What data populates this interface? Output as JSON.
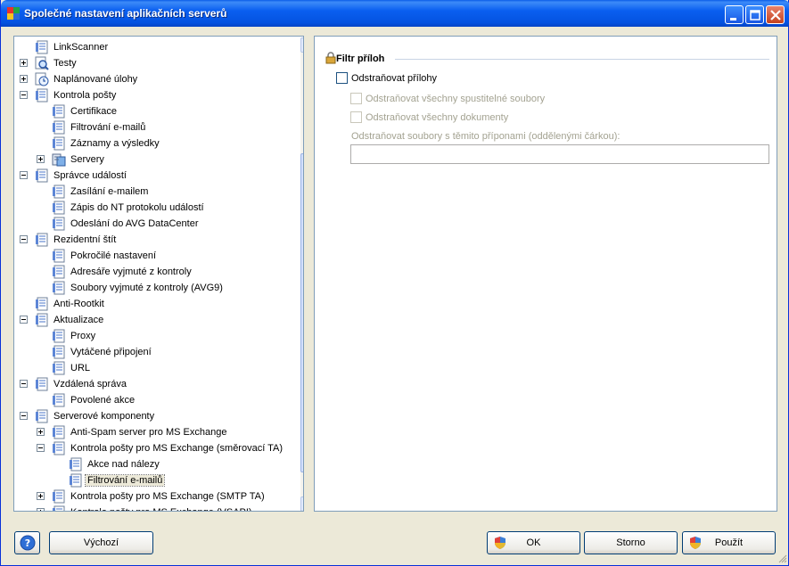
{
  "window": {
    "title": "Společné nastavení aplikačních serverů",
    "accent": "#0a5ee8"
  },
  "tree": {
    "items": [
      {
        "label": "LinkScanner",
        "depth": 0,
        "expander": "none",
        "icon": "document-icon"
      },
      {
        "label": "Testy",
        "depth": 0,
        "expander": "plus",
        "icon": "magnifier-icon"
      },
      {
        "label": "Naplánované úlohy",
        "depth": 0,
        "expander": "plus",
        "icon": "clock-icon"
      },
      {
        "label": "Kontrola pošty",
        "depth": 0,
        "expander": "minus",
        "icon": "document-icon"
      },
      {
        "label": "Certifikace",
        "depth": 1,
        "expander": "none",
        "icon": "document-icon"
      },
      {
        "label": "Filtrování e-mailů",
        "depth": 1,
        "expander": "none",
        "icon": "document-icon"
      },
      {
        "label": "Záznamy a výsledky",
        "depth": 1,
        "expander": "none",
        "icon": "document-icon"
      },
      {
        "label": "Servery",
        "depth": 1,
        "expander": "plus",
        "icon": "server-icon"
      },
      {
        "label": "Správce událostí",
        "depth": 0,
        "expander": "minus",
        "icon": "document-icon"
      },
      {
        "label": "Zasílání e-mailem",
        "depth": 1,
        "expander": "none",
        "icon": "document-icon"
      },
      {
        "label": "Zápis do NT protokolu událostí",
        "depth": 1,
        "expander": "none",
        "icon": "document-icon"
      },
      {
        "label": "Odeslání do AVG DataCenter",
        "depth": 1,
        "expander": "none",
        "icon": "document-icon"
      },
      {
        "label": "Rezidentní štít",
        "depth": 0,
        "expander": "minus",
        "icon": "document-icon"
      },
      {
        "label": "Pokročilé nastavení",
        "depth": 1,
        "expander": "none",
        "icon": "document-icon"
      },
      {
        "label": "Adresáře vyjmuté z kontroly",
        "depth": 1,
        "expander": "none",
        "icon": "document-icon"
      },
      {
        "label": "Soubory vyjmuté z kontroly (AVG9)",
        "depth": 1,
        "expander": "none",
        "icon": "document-icon"
      },
      {
        "label": "Anti-Rootkit",
        "depth": 0,
        "expander": "none",
        "icon": "document-icon"
      },
      {
        "label": "Aktualizace",
        "depth": 0,
        "expander": "minus",
        "icon": "document-icon"
      },
      {
        "label": "Proxy",
        "depth": 1,
        "expander": "none",
        "icon": "document-icon"
      },
      {
        "label": "Vytáčené připojení",
        "depth": 1,
        "expander": "none",
        "icon": "document-icon"
      },
      {
        "label": "URL",
        "depth": 1,
        "expander": "none",
        "icon": "document-icon"
      },
      {
        "label": "Vzdálená správa",
        "depth": 0,
        "expander": "minus",
        "icon": "document-icon"
      },
      {
        "label": "Povolené akce",
        "depth": 1,
        "expander": "none",
        "icon": "document-icon"
      },
      {
        "label": "Serverové komponenty",
        "depth": 0,
        "expander": "minus",
        "icon": "document-icon"
      },
      {
        "label": "Anti-Spam server pro MS Exchange",
        "depth": 1,
        "expander": "plus",
        "icon": "document-icon"
      },
      {
        "label": "Kontrola pošty pro MS Exchange (směrovací TA)",
        "depth": 1,
        "expander": "minus",
        "icon": "document-icon"
      },
      {
        "label": "Akce nad nálezy",
        "depth": 2,
        "expander": "none",
        "icon": "document-icon"
      },
      {
        "label": "Filtrování e-mailů",
        "depth": 2,
        "expander": "none",
        "icon": "document-icon",
        "selected": true
      },
      {
        "label": "Kontrola pošty pro MS Exchange (SMTP TA)",
        "depth": 1,
        "expander": "plus",
        "icon": "document-icon"
      },
      {
        "label": "Kontrola pošty pro MS Exchange (VSAPI)",
        "depth": 1,
        "expander": "plus",
        "icon": "document-icon"
      }
    ]
  },
  "panel": {
    "section_title": "Filtr příloh",
    "remove_attachments": {
      "label": "Odstraňovat přílohy",
      "checked": false
    },
    "remove_executables": {
      "label": "Odstraňovat všechny spustitelné soubory",
      "checked": false
    },
    "remove_documents": {
      "label": "Odstraňovat všechny dokumenty",
      "checked": false
    },
    "extensions_label": "Odstraňovat soubory s těmito příponami (oddělenými čárkou):",
    "extensions_value": ""
  },
  "buttons": {
    "default_label": "Výchozí",
    "ok_label": "OK",
    "cancel_label": "Storno",
    "apply_label": "Použít"
  }
}
